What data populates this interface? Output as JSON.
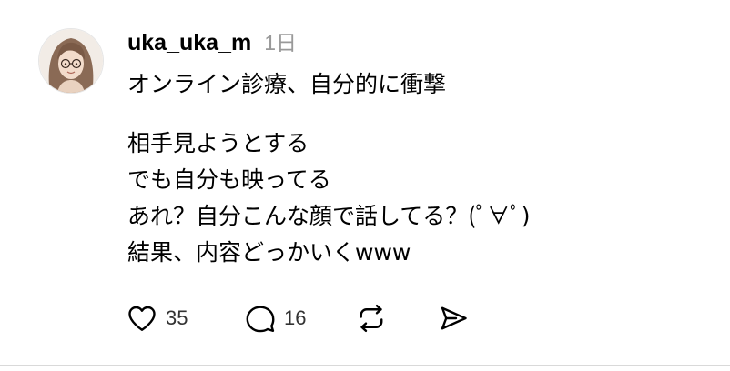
{
  "post": {
    "username": "uka_uka_m",
    "timestamp": "1日",
    "first_line": "オンライン診療、自分的に衝撃",
    "body_lines": [
      "相手見ようとする",
      "でも自分も映ってる",
      "あれ？自分こんな顔で話してる？(ﾟ∀ﾟ)",
      "結果、内容どっかいくwww"
    ]
  },
  "actions": {
    "like_count": "35",
    "reply_count": "16"
  },
  "icons": {
    "like": "heart-icon",
    "reply": "speech-bubble-icon",
    "repost": "repost-icon",
    "share": "send-icon"
  },
  "colors": {
    "text": "#000000",
    "muted": "#999999",
    "icon": "#000000"
  }
}
